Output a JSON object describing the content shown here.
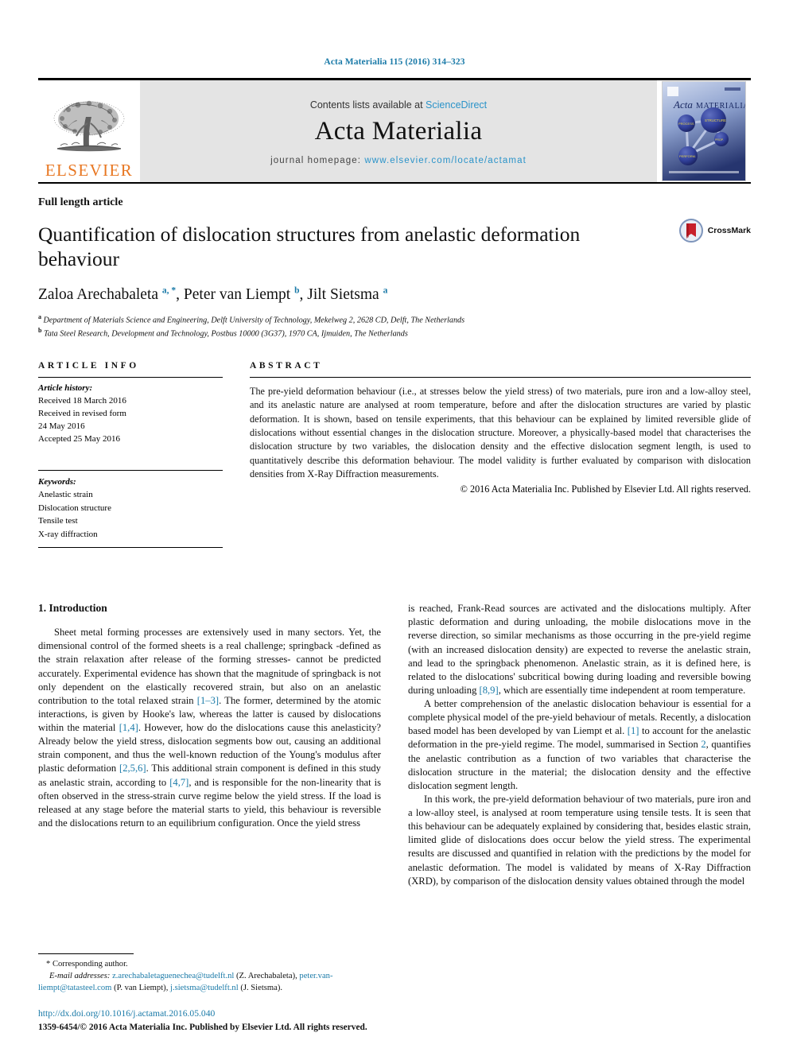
{
  "running_head": "Acta Materialia 115 (2016) 314–323",
  "masthead": {
    "publisher_name": "ELSEVIER",
    "contents_prefix": "Contents lists available at ",
    "contents_link": "ScienceDirect",
    "journal_name": "Acta Materialia",
    "homepage_label": "journal homepage: ",
    "homepage_url": "www.elsevier.com/locate/actamat",
    "cover_title_italic": "Acta",
    "cover_title_rest": "MATERIALIA",
    "cover_nodes": [
      "PROCESSING",
      "STRUCTURE",
      "PROPERTIES",
      "PERFORMANCE"
    ]
  },
  "article": {
    "type": "Full length article",
    "title": "Quantification of dislocation structures from anelastic deformation behaviour",
    "crossmark_label": "CrossMark",
    "authors_html": "Zaloa Arechabaleta <sup>a, *</sup>, Peter van Liempt <sup>b</sup>, Jilt Sietsma <sup>a</sup>",
    "affiliations": [
      "Department of Materials Science and Engineering, Delft University of Technology, Mekelweg 2, 2628 CD, Delft, The Netherlands",
      "Tata Steel Research, Development and Technology, Postbus 10000 (3G37), 1970 CA, Ijmuiden, The Netherlands"
    ]
  },
  "info": {
    "heading": "ARTICLE INFO",
    "history_label": "Article history:",
    "history_lines": [
      "Received 18 March 2016",
      "Received in revised form",
      "24 May 2016",
      "Accepted 25 May 2016"
    ],
    "keywords_label": "Keywords:",
    "keywords": [
      "Anelastic strain",
      "Dislocation structure",
      "Tensile test",
      "X-ray diffraction"
    ]
  },
  "abstract": {
    "heading": "ABSTRACT",
    "text": "The pre-yield deformation behaviour (i.e., at stresses below the yield stress) of two materials, pure iron and a low-alloy steel, and its anelastic nature are analysed at room temperature, before and after the dislocation structures are varied by plastic deformation. It is shown, based on tensile experiments, that this behaviour can be explained by limited reversible glide of dislocations without essential changes in the dislocation structure. Moreover, a physically-based model that characterises the dislocation structure by two variables, the dislocation density and the effective dislocation segment length, is used to quantitatively describe this deformation behaviour. The model validity is further evaluated by comparison with dislocation densities from X-Ray Diffraction measurements.",
    "copyright": "© 2016 Acta Materialia Inc. Published by Elsevier Ltd. All rights reserved."
  },
  "body": {
    "section_number_title": "1. Introduction",
    "left_paragraphs": [
      "Sheet metal forming processes are extensively used in many sectors. Yet, the dimensional control of the formed sheets is a real challenge; springback -defined as the strain relaxation after release of the forming stresses- cannot be predicted accurately. Experimental evidence has shown that the magnitude of springback is not only dependent on the elastically recovered strain, but also on an anelastic contribution to the total relaxed strain [1–3]. The former, determined by the atomic interactions, is given by Hooke's law, whereas the latter is caused by dislocations within the material [1,4]. However, how do the dislocations cause this anelasticity? Already below the yield stress, dislocation segments bow out, causing an additional strain component, and thus the well-known reduction of the Young's modulus after plastic deformation [2,5,6]. This additional strain component is defined in this study as anelastic strain, according to [4,7], and is responsible for the non-linearity that is often observed in the stress-strain curve regime below the yield stress. If the load is released at any stage before the material starts to yield, this behaviour is reversible and the dislocations return to an equilibrium configuration. Once the yield stress"
    ],
    "right_paragraphs": [
      "is reached, Frank-Read sources are activated and the dislocations multiply. After plastic deformation and during unloading, the mobile dislocations move in the reverse direction, so similar mechanisms as those occurring in the pre-yield regime (with an increased dislocation density) are expected to reverse the anelastic strain, and lead to the springback phenomenon. Anelastic strain, as it is defined here, is related to the dislocations' subcritical bowing during loading and reversible bowing during unloading [8,9], which are essentially time independent at room temperature.",
      "A better comprehension of the anelastic dislocation behaviour is essential for a complete physical model of the pre-yield behaviour of metals. Recently, a dislocation based model has been developed by van Liempt et al. [1] to account for the anelastic deformation in the pre-yield regime. The model, summarised in Section 2, quantifies the anelastic contribution as a function of two variables that characterise the dislocation structure in the material; the dislocation density and the effective dislocation segment length.",
      "In this work, the pre-yield deformation behaviour of two materials, pure iron and a low-alloy steel, is analysed at room temperature using tensile tests. It is seen that this behaviour can be adequately explained by considering that, besides elastic strain, limited glide of dislocations does occur below the yield stress. The experimental results are discussed and quantified in relation with the predictions by the model for anelastic deformation. The model is validated by means of X-Ray Diffraction (XRD), by comparison of the dislocation density values obtained through the model"
    ]
  },
  "footnote": {
    "corresponding": "* Corresponding author.",
    "email_label": "E-mail addresses:",
    "emails": [
      {
        "address": "z.arechabaletaguenechea@tudelft.nl",
        "name": "(Z. Arechabaleta)"
      },
      {
        "address": "peter.van-liempt@tatasteel.com",
        "name": "(P. van Liempt)"
      },
      {
        "address": "j.sietsma@tudelft.nl",
        "name": "(J. Sietsma)"
      }
    ],
    "doi": "http://dx.doi.org/10.1016/j.actamat.2016.05.040",
    "issn_line": "1359-6454/© 2016 Acta Materialia Inc. Published by Elsevier Ltd. All rights reserved."
  },
  "colors": {
    "link_blue": "#1a7aa8",
    "elsevier_orange": "#E87722",
    "masthead_grey": "#e4e4e4"
  }
}
